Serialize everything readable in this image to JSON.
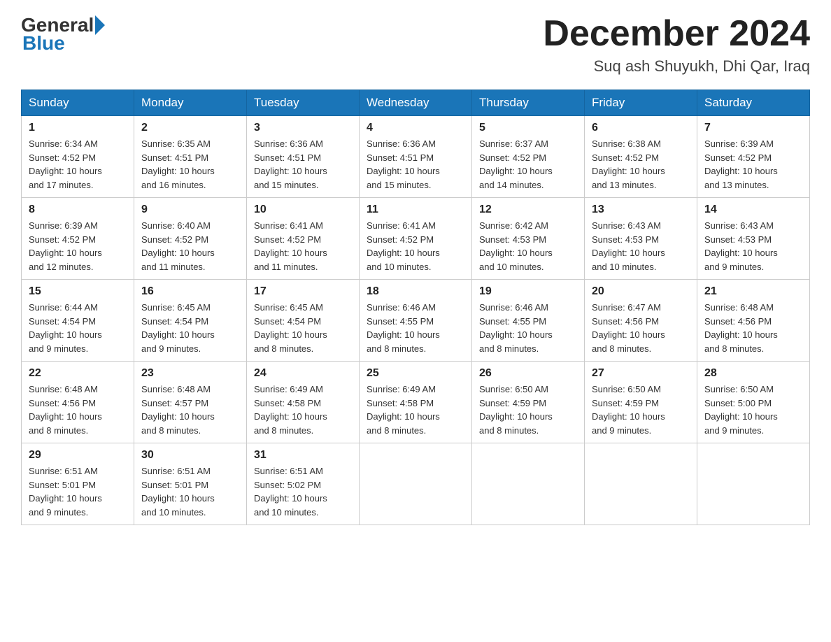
{
  "header": {
    "logo_general": "General",
    "logo_blue": "Blue",
    "month_title": "December 2024",
    "location": "Suq ash Shuyukh, Dhi Qar, Iraq"
  },
  "days_of_week": [
    "Sunday",
    "Monday",
    "Tuesday",
    "Wednesday",
    "Thursday",
    "Friday",
    "Saturday"
  ],
  "weeks": [
    [
      {
        "day": "1",
        "sunrise": "6:34 AM",
        "sunset": "4:52 PM",
        "daylight": "10 hours and 17 minutes."
      },
      {
        "day": "2",
        "sunrise": "6:35 AM",
        "sunset": "4:51 PM",
        "daylight": "10 hours and 16 minutes."
      },
      {
        "day": "3",
        "sunrise": "6:36 AM",
        "sunset": "4:51 PM",
        "daylight": "10 hours and 15 minutes."
      },
      {
        "day": "4",
        "sunrise": "6:36 AM",
        "sunset": "4:51 PM",
        "daylight": "10 hours and 15 minutes."
      },
      {
        "day": "5",
        "sunrise": "6:37 AM",
        "sunset": "4:52 PM",
        "daylight": "10 hours and 14 minutes."
      },
      {
        "day": "6",
        "sunrise": "6:38 AM",
        "sunset": "4:52 PM",
        "daylight": "10 hours and 13 minutes."
      },
      {
        "day": "7",
        "sunrise": "6:39 AM",
        "sunset": "4:52 PM",
        "daylight": "10 hours and 13 minutes."
      }
    ],
    [
      {
        "day": "8",
        "sunrise": "6:39 AM",
        "sunset": "4:52 PM",
        "daylight": "10 hours and 12 minutes."
      },
      {
        "day": "9",
        "sunrise": "6:40 AM",
        "sunset": "4:52 PM",
        "daylight": "10 hours and 11 minutes."
      },
      {
        "day": "10",
        "sunrise": "6:41 AM",
        "sunset": "4:52 PM",
        "daylight": "10 hours and 11 minutes."
      },
      {
        "day": "11",
        "sunrise": "6:41 AM",
        "sunset": "4:52 PM",
        "daylight": "10 hours and 10 minutes."
      },
      {
        "day": "12",
        "sunrise": "6:42 AM",
        "sunset": "4:53 PM",
        "daylight": "10 hours and 10 minutes."
      },
      {
        "day": "13",
        "sunrise": "6:43 AM",
        "sunset": "4:53 PM",
        "daylight": "10 hours and 10 minutes."
      },
      {
        "day": "14",
        "sunrise": "6:43 AM",
        "sunset": "4:53 PM",
        "daylight": "10 hours and 9 minutes."
      }
    ],
    [
      {
        "day": "15",
        "sunrise": "6:44 AM",
        "sunset": "4:54 PM",
        "daylight": "10 hours and 9 minutes."
      },
      {
        "day": "16",
        "sunrise": "6:45 AM",
        "sunset": "4:54 PM",
        "daylight": "10 hours and 9 minutes."
      },
      {
        "day": "17",
        "sunrise": "6:45 AM",
        "sunset": "4:54 PM",
        "daylight": "10 hours and 8 minutes."
      },
      {
        "day": "18",
        "sunrise": "6:46 AM",
        "sunset": "4:55 PM",
        "daylight": "10 hours and 8 minutes."
      },
      {
        "day": "19",
        "sunrise": "6:46 AM",
        "sunset": "4:55 PM",
        "daylight": "10 hours and 8 minutes."
      },
      {
        "day": "20",
        "sunrise": "6:47 AM",
        "sunset": "4:56 PM",
        "daylight": "10 hours and 8 minutes."
      },
      {
        "day": "21",
        "sunrise": "6:48 AM",
        "sunset": "4:56 PM",
        "daylight": "10 hours and 8 minutes."
      }
    ],
    [
      {
        "day": "22",
        "sunrise": "6:48 AM",
        "sunset": "4:56 PM",
        "daylight": "10 hours and 8 minutes."
      },
      {
        "day": "23",
        "sunrise": "6:48 AM",
        "sunset": "4:57 PM",
        "daylight": "10 hours and 8 minutes."
      },
      {
        "day": "24",
        "sunrise": "6:49 AM",
        "sunset": "4:58 PM",
        "daylight": "10 hours and 8 minutes."
      },
      {
        "day": "25",
        "sunrise": "6:49 AM",
        "sunset": "4:58 PM",
        "daylight": "10 hours and 8 minutes."
      },
      {
        "day": "26",
        "sunrise": "6:50 AM",
        "sunset": "4:59 PM",
        "daylight": "10 hours and 8 minutes."
      },
      {
        "day": "27",
        "sunrise": "6:50 AM",
        "sunset": "4:59 PM",
        "daylight": "10 hours and 9 minutes."
      },
      {
        "day": "28",
        "sunrise": "6:50 AM",
        "sunset": "5:00 PM",
        "daylight": "10 hours and 9 minutes."
      }
    ],
    [
      {
        "day": "29",
        "sunrise": "6:51 AM",
        "sunset": "5:01 PM",
        "daylight": "10 hours and 9 minutes."
      },
      {
        "day": "30",
        "sunrise": "6:51 AM",
        "sunset": "5:01 PM",
        "daylight": "10 hours and 10 minutes."
      },
      {
        "day": "31",
        "sunrise": "6:51 AM",
        "sunset": "5:02 PM",
        "daylight": "10 hours and 10 minutes."
      },
      null,
      null,
      null,
      null
    ]
  ],
  "labels": {
    "sunrise": "Sunrise:",
    "sunset": "Sunset:",
    "daylight": "Daylight:"
  }
}
